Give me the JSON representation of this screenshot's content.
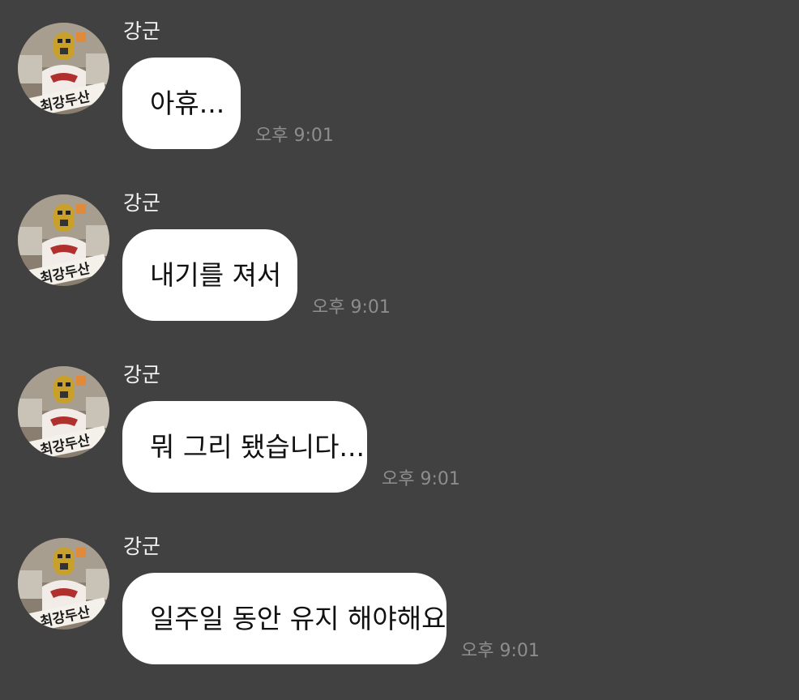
{
  "chat": {
    "messages": [
      {
        "sender": "강군",
        "text": "아휴...",
        "time": "오후 9:01"
      },
      {
        "sender": "강군",
        "text": "내기를 져서",
        "time": "오후 9:01"
      },
      {
        "sender": "강군",
        "text": "뭐 그리 됐습니다...",
        "time": "오후 9:01"
      },
      {
        "sender": "강군",
        "text": "일주일 동안 유지 해야해요",
        "time": "오후 9:01"
      }
    ],
    "avatar_sign_text": "최강두산",
    "colors": {
      "background": "#414141",
      "bubble": "#ffffff",
      "time": "#8d8d8d",
      "sender": "#f2f2f2"
    }
  }
}
